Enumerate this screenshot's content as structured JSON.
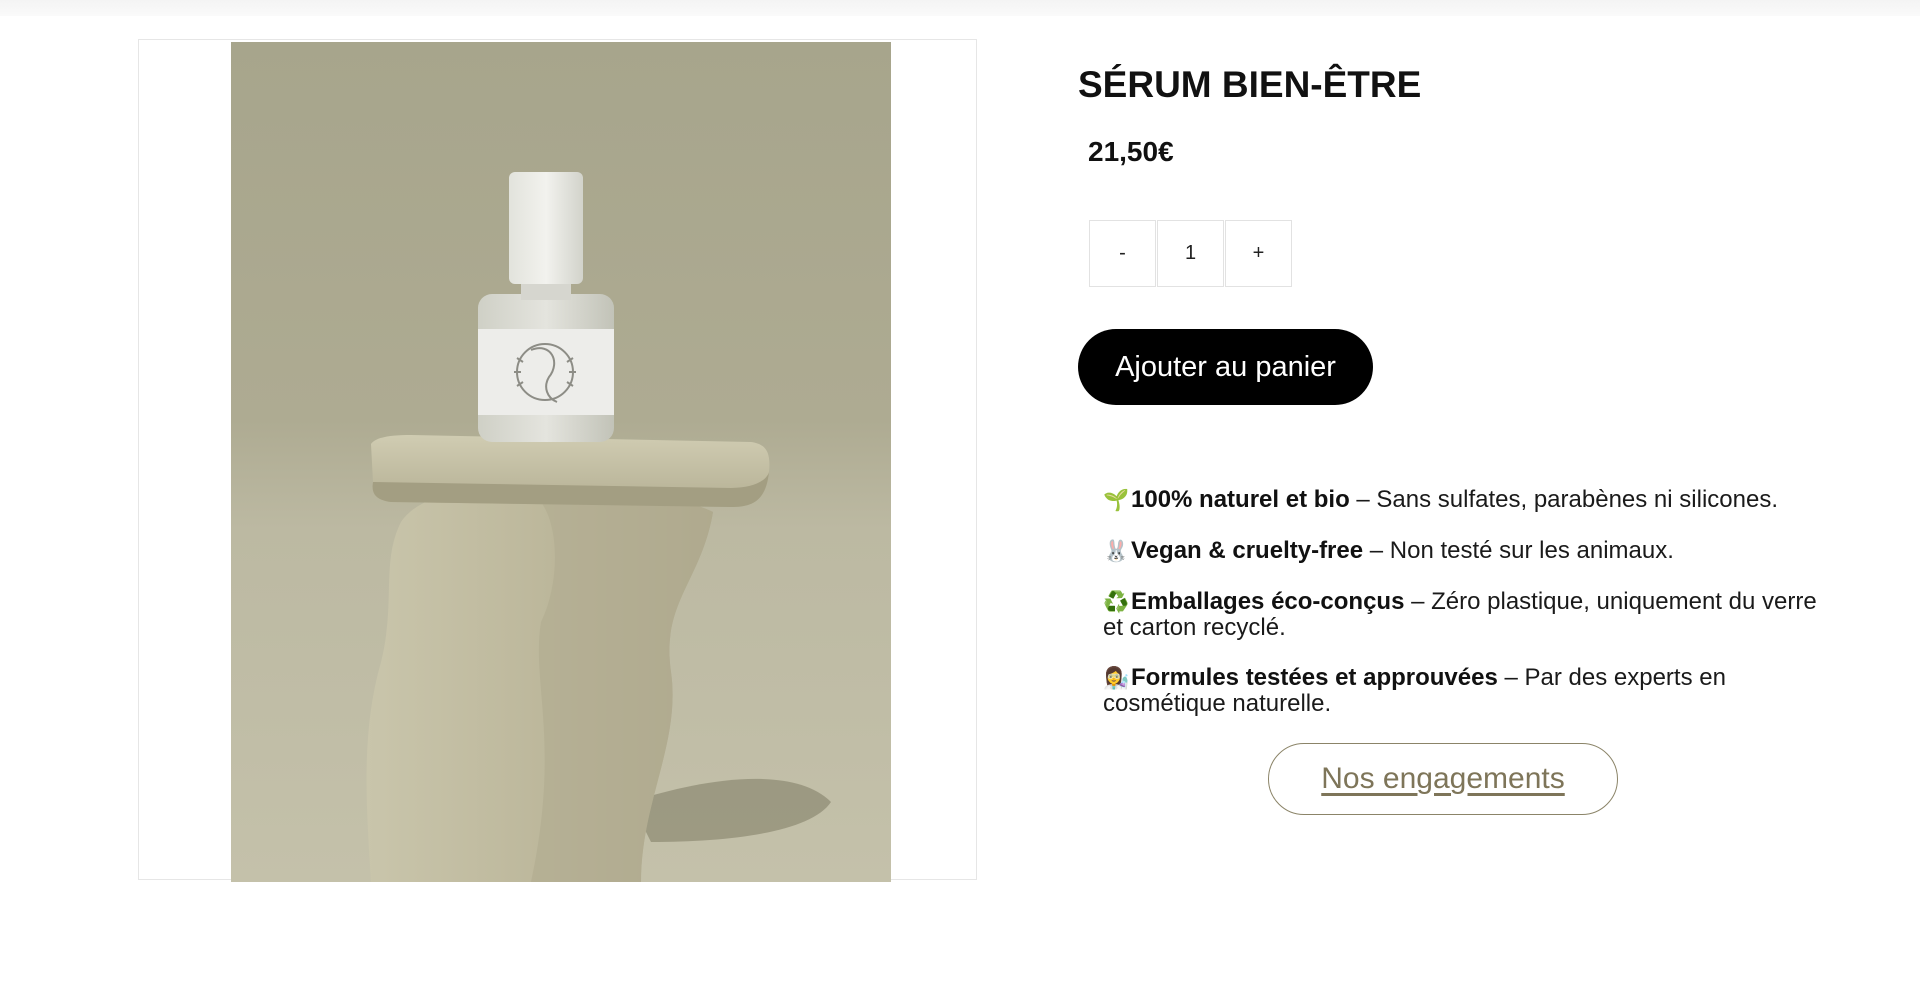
{
  "product": {
    "title": "SÉRUM BIEN-ÊTRE",
    "price": "21,50€",
    "image_alt": "Flacon de sérum posé sur une pierre"
  },
  "quantity": {
    "decrease_label": "-",
    "value": "1",
    "increase_label": "+"
  },
  "cart": {
    "add_label": "Ajouter au panier"
  },
  "features": [
    {
      "icon": "seedling-icon",
      "emoji": "🌱",
      "title": "100% naturel et bio",
      "text": " – Sans sulfates, parabènes ni silicones."
    },
    {
      "icon": "rabbit-icon",
      "emoji": "🐰",
      "title": "Vegan & cruelty-free",
      "text": " – Non testé sur les animaux."
    },
    {
      "icon": "recycle-icon",
      "emoji": "♻️",
      "title": "Emballages éco-conçus",
      "text": " – Zéro plastique, uniquement du verre et carton recyclé."
    },
    {
      "icon": "scientist-icon",
      "emoji": "👩‍🔬",
      "title": "Formules testées et approuvées",
      "text": " – Par des experts en cosmétique naturelle."
    }
  ],
  "engagements": {
    "label": "Nos engagements"
  },
  "colors": {
    "cart_button": "#000000",
    "engagements_text": "#7e7559",
    "engagements_border": "#8b8468",
    "photo_background": "#aeab92"
  }
}
